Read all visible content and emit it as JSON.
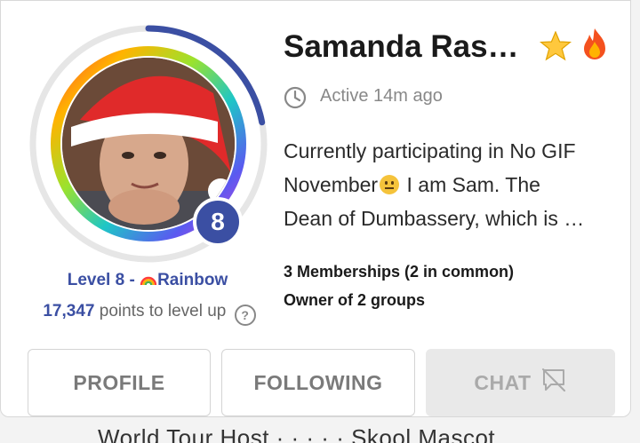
{
  "user": {
    "name": "Samanda Ras…",
    "status": "Active 14m ago",
    "level_number": "8",
    "level_label": "Level 8 - ",
    "level_tier": "Rainbow",
    "points": "17,347",
    "points_suffix": " points to level up",
    "bio_lines": [
      "Currently participating in No GIF",
      "November",
      " I am Sam. The",
      "Dean of Dumbassery, which is …"
    ],
    "memberships": "3 Memberships (2 in common)",
    "owner": "Owner of 2 groups"
  },
  "actions": {
    "profile_label": "PROFILE",
    "following_label": "FOLLOWING",
    "chat_label": "CHAT"
  },
  "background": {
    "peek_text": "World Tour Host  · · · · ·  Skool Mascot"
  },
  "icons": {
    "star": "star-icon",
    "fire": "fire-icon",
    "clock": "clock-icon",
    "help": "help-icon",
    "rainbow": "rainbow-icon",
    "chat_disabled": "chat-off-icon"
  },
  "colors": {
    "accent": "#3b4fa3",
    "muted_text": "#888888",
    "disabled_bg": "#e9e9e9"
  },
  "progress": {
    "level_ring_fraction": 0.22
  }
}
